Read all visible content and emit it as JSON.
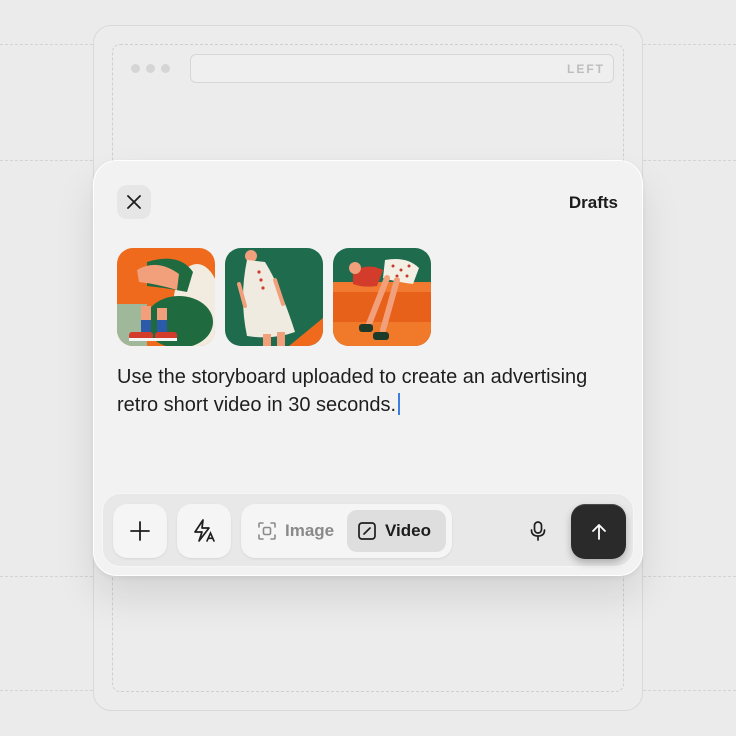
{
  "background_window": {
    "address_bar_label": "LEFT"
  },
  "composer": {
    "header": {
      "close_icon": "close-icon",
      "drafts_label": "Drafts"
    },
    "attachments": [
      {
        "name": "storyboard-frame-1"
      },
      {
        "name": "storyboard-frame-2"
      },
      {
        "name": "storyboard-frame-3"
      }
    ],
    "prompt_text": "Use the storyboard uploaded to create an advertising retro short video in 30 seconds.",
    "toolbar": {
      "add_icon": "plus-icon",
      "style_icon": "sparkle-text-icon",
      "mode_options": [
        {
          "label": "Image",
          "icon": "image-scan-icon",
          "selected": false
        },
        {
          "label": "Video",
          "icon": "video-frame-icon",
          "selected": true
        }
      ],
      "mic_icon": "microphone-icon",
      "send_icon": "arrow-up-icon"
    }
  },
  "colors": {
    "accent_caret": "#3b7ee0",
    "send_button": "#2a2a2a",
    "art_orange": "#f06a1e",
    "art_green": "#1e6b4e"
  }
}
